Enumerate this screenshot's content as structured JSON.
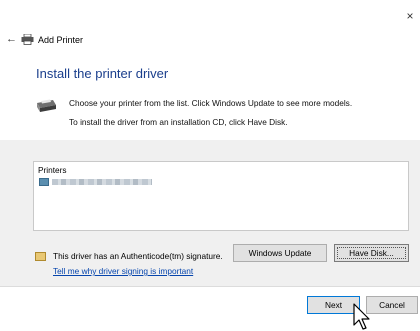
{
  "window": {
    "title": "Add Printer",
    "close_glyph": "×",
    "back_glyph": "←"
  },
  "page": {
    "heading": "Install the printer driver",
    "description_line1": "Choose your printer from the list. Click Windows Update to see more models.",
    "description_line2": "To install the driver from an installation CD, click Have Disk."
  },
  "printers_list": {
    "header": "Printers",
    "items": [
      {
        "icon": "printer-model-icon",
        "label_redacted": true
      }
    ]
  },
  "signature": {
    "text": "This driver has an Authenticode(tm) signature.",
    "link": "Tell me why driver signing is important"
  },
  "buttons": {
    "windows_update": "Windows Update",
    "have_disk": "Have Disk...",
    "next": "Next",
    "cancel": "Cancel"
  },
  "colors": {
    "heading": "#1a3e8c",
    "link": "#0645ad",
    "button_bg": "#e1e1e1",
    "focus_border": "#0078d7",
    "panel_bg": "#f0f0f0"
  }
}
